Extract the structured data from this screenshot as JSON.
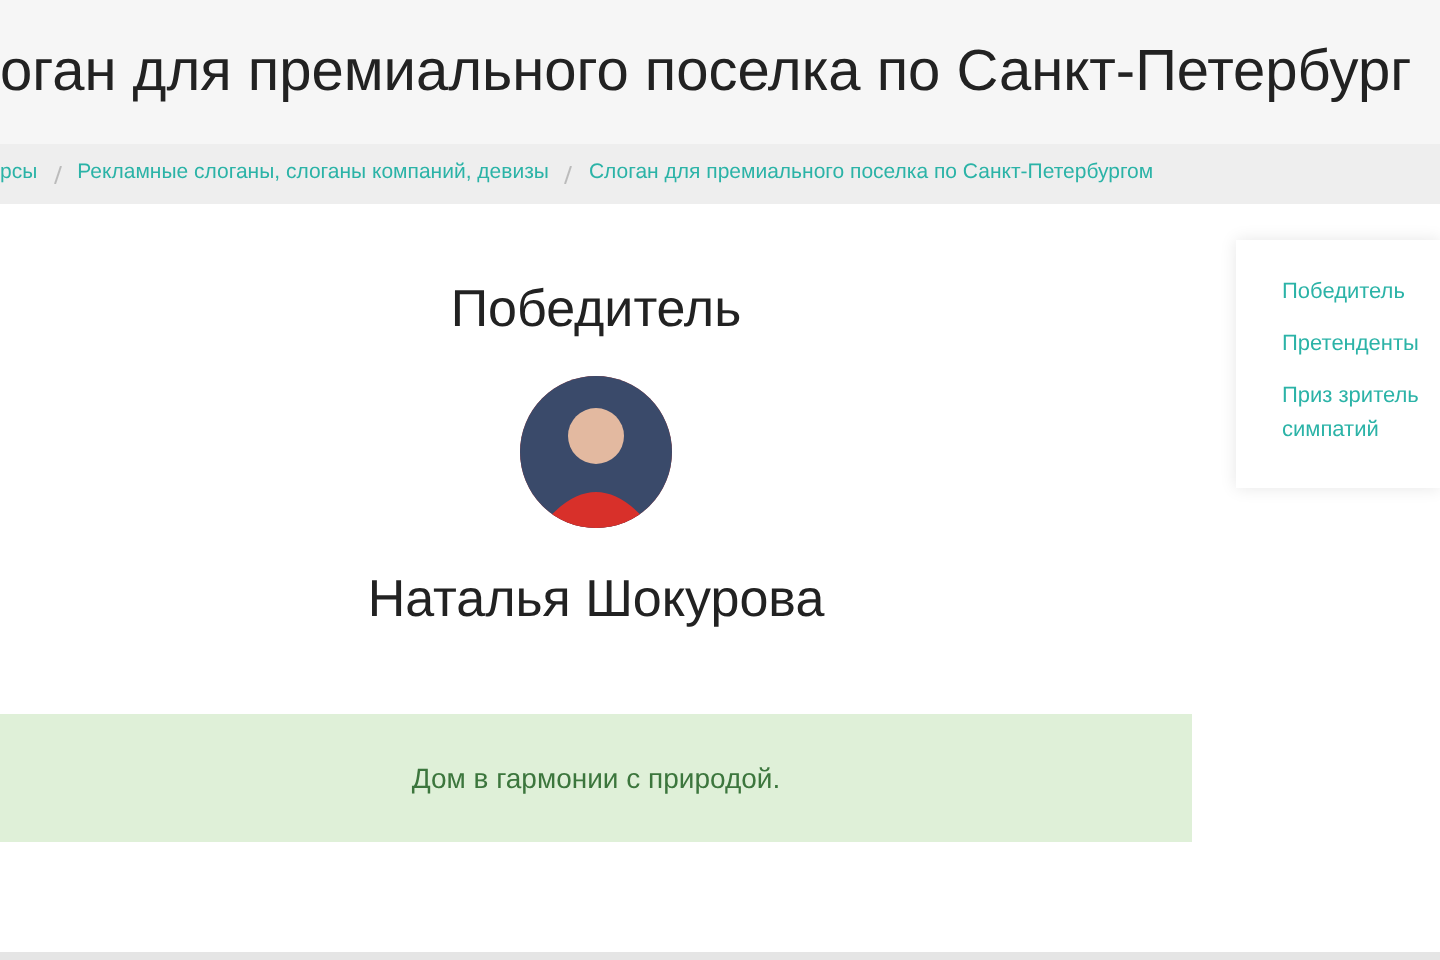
{
  "page_title": "оган для премиального поселка по Санкт-Петербург",
  "breadcrumbs": [
    {
      "label": "рсы",
      "active": false
    },
    {
      "label": "Рекламные слоганы, слоганы компаний, девизы",
      "active": false
    },
    {
      "label": "Слоган для премиального поселка по Санкт-Петербургом",
      "active": false
    }
  ],
  "winner": {
    "heading": "Победитель",
    "name": "Наталья Шокурова",
    "slogan": "Дом в гармонии с природой."
  },
  "side_menu": [
    {
      "lines": [
        "Победитель"
      ]
    },
    {
      "lines": [
        "Претенденты"
      ]
    },
    {
      "lines": [
        "Приз зритель",
        "симпатий"
      ]
    }
  ]
}
